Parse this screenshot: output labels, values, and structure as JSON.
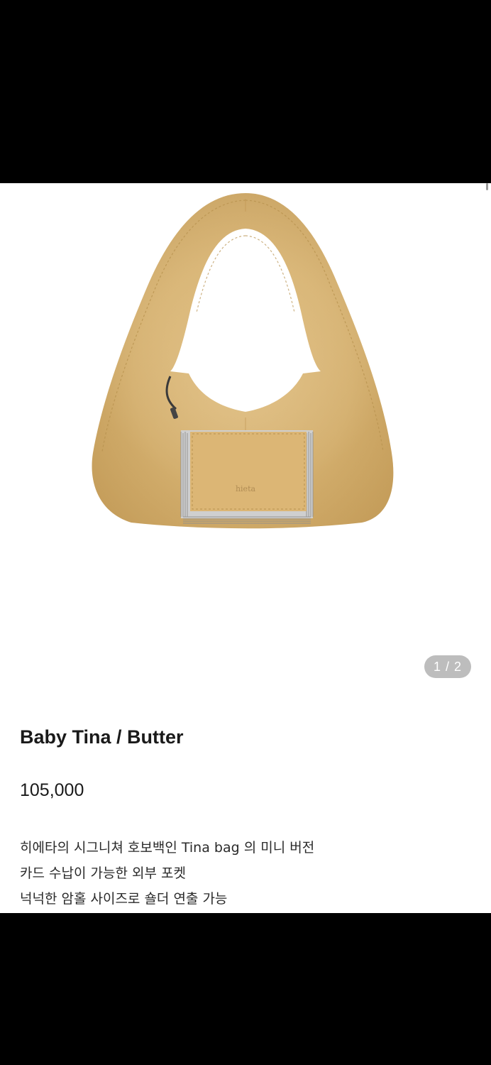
{
  "product": {
    "image_alt": "handbag",
    "image_counter": "1 / 2",
    "name": "Baby Tina / Butter",
    "price": "105,000",
    "description": [
      "히에타의 시그니쳐 호보백인 Tina bag 의 미니 버전",
      "카드 수납이 가능한 외부 포켓",
      "넉넉한 암홀 사이즈로 숄더 연출 가능"
    ]
  },
  "colors": {
    "bag": "#dcb97a",
    "fringe": "#9a9a9a",
    "background": "#ffffff",
    "counter_bg": "#bdbdbd"
  }
}
